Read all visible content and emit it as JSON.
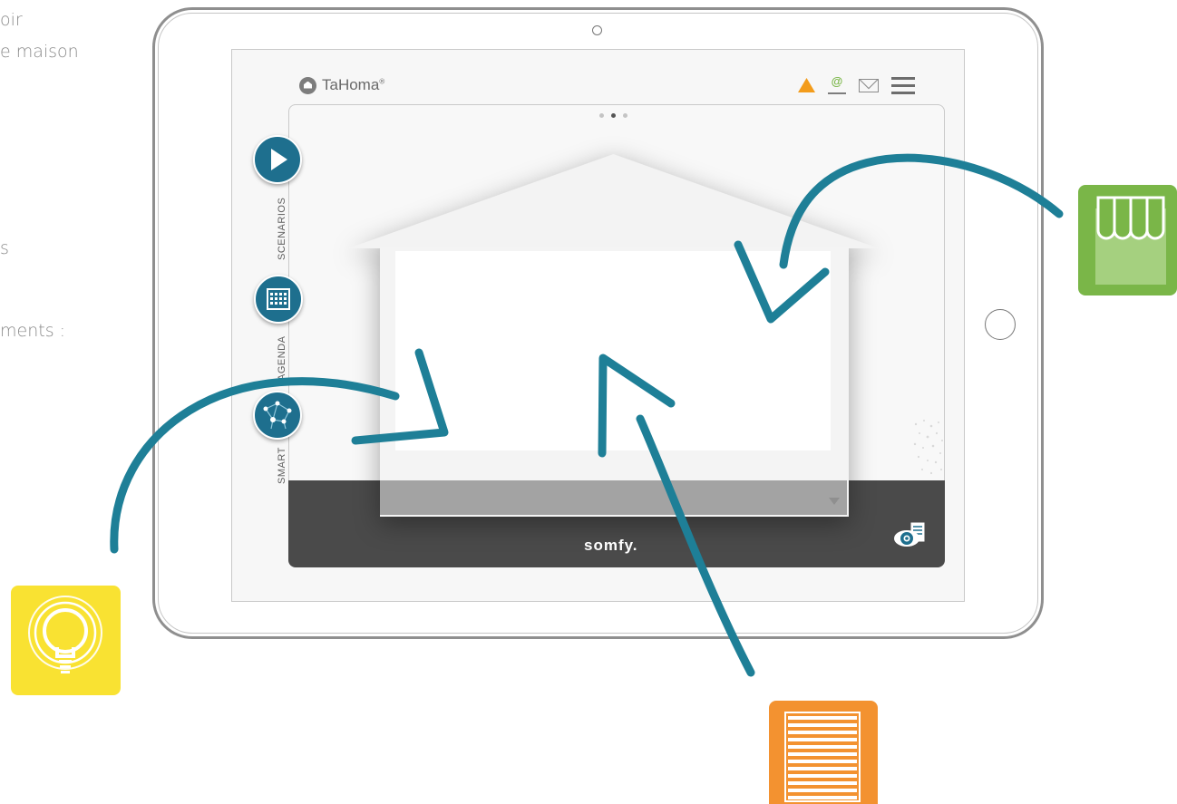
{
  "left_text": [
    "oir",
    "e maison",
    "s",
    "ments :"
  ],
  "app": {
    "name": "TaHoma",
    "reg_mark": "®"
  },
  "header_icons": [
    "warning-icon",
    "connection-icon",
    "mail-icon",
    "menu-icon"
  ],
  "nav": [
    {
      "label": "SCENARIOS",
      "icon": "play-icon"
    },
    {
      "label": "AGENDA",
      "icon": "calendar-icon"
    },
    {
      "label": "SMART",
      "icon": "network-icon"
    }
  ],
  "brand": "somfy.",
  "tiles": [
    {
      "icon": "awning-icon",
      "color": "#7ab648"
    },
    {
      "icon": "lightbulb-icon",
      "color": "#f9e232"
    },
    {
      "icon": "roller-shutter-icon",
      "color": "#f39230"
    }
  ],
  "colors": {
    "accent": "#1e6f8e",
    "arrow": "#1e7f97",
    "warning": "#f39c1b",
    "bar": "#4a4a4a"
  }
}
